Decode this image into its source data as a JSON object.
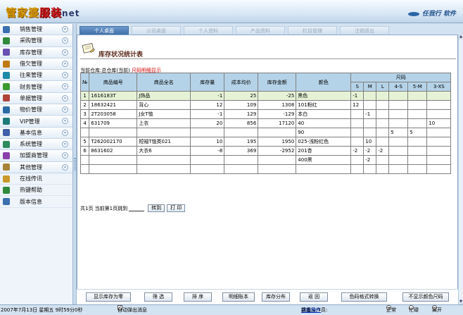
{
  "header": {
    "logo_part1": "管家婆",
    "logo_part2": "服装",
    "logo_part3": "net",
    "brand_text": "任我行 软件"
  },
  "sidebar": {
    "items": [
      {
        "label": "销售管理",
        "icon": "sales-icon",
        "color": "#3a6fb0"
      },
      {
        "label": "采购管理",
        "icon": "purchase-icon",
        "color": "#2f8a3c"
      },
      {
        "label": "库存管理",
        "icon": "inventory-icon",
        "color": "#6a4fb2"
      },
      {
        "label": "借欠管理",
        "icon": "loan-icon",
        "color": "#c07a14"
      },
      {
        "label": "往来管理",
        "icon": "contacts-icon",
        "color": "#1c8aa8"
      },
      {
        "label": "财务管理",
        "icon": "finance-icon",
        "color": "#3d9a2e"
      },
      {
        "label": "单据管理",
        "icon": "documents-icon",
        "color": "#b0443a"
      },
      {
        "label": "物价管理",
        "icon": "price-icon",
        "color": "#2c6aa6"
      },
      {
        "label": "VIP管理",
        "icon": "vip-icon",
        "color": "#1d7a7a"
      },
      {
        "label": "基本信息",
        "icon": "basic-info-icon",
        "color": "#3f5fa8"
      },
      {
        "label": "系统管理",
        "icon": "system-icon",
        "color": "#2d8a5a"
      },
      {
        "label": "加盟商管理",
        "icon": "franchise-icon",
        "color": "#8a3fa8"
      },
      {
        "label": "其他管理",
        "icon": "other-icon",
        "color": "#a8843a"
      }
    ],
    "plain_items": [
      {
        "label": "在线传讯",
        "icon": "speaker-icon",
        "color": "#c99a2a"
      },
      {
        "label": "热键帮助",
        "icon": "hotkey-icon",
        "color": "#2f8a3c"
      },
      {
        "label": "版本信息",
        "icon": "version-icon",
        "color": "#3a6fb0"
      }
    ]
  },
  "tabs": [
    "个人桌面",
    "公司桌面",
    "个人资料",
    "产品资料",
    "栏目管理",
    "注销退出"
  ],
  "report": {
    "title": "库存状况统计表",
    "warehouse_label": "当前仓库:总仓库(当前)",
    "size_detail_label": "尺码明细显示"
  },
  "table": {
    "headers": [
      "№",
      "商品编号",
      "商品全名",
      "库存量",
      "成本均价",
      "库存金额",
      "颜色",
      "尺码"
    ],
    "sizes": [
      "S",
      "M",
      "L",
      "4-S",
      "5-M",
      "3-XS"
    ],
    "rows": [
      {
        "no": "1",
        "code": "1616183T",
        "name": "J饰品",
        "qty": "-1",
        "avg": "25",
        "amount": "-25",
        "color": "黑色",
        "s": [
          "-1",
          "",
          "",
          "",
          "",
          ""
        ],
        "hl": true
      },
      {
        "no": "2",
        "code": "18632421",
        "name": "背心",
        "qty": "12",
        "avg": "109",
        "amount": "1308",
        "color": "101粉红",
        "s": [
          "12",
          "",
          "",
          "",
          "",
          ""
        ],
        "hl": false
      },
      {
        "no": "3",
        "code": "2T203058",
        "name": "J女T恤",
        "qty": "-1",
        "avg": "129",
        "amount": "-129",
        "color": "本白",
        "s": [
          "",
          "-1",
          "",
          "",
          "",
          ""
        ],
        "hl": false
      },
      {
        "no": "4",
        "code": "631709",
        "name": "上衣",
        "qty": "20",
        "avg": "856",
        "amount": "17120",
        "color": "40",
        "s": [
          "",
          "",
          "",
          "",
          "",
          "10"
        ],
        "hl": false
      },
      {
        "no": "",
        "code": "",
        "name": "",
        "qty": "",
        "avg": "",
        "amount": "",
        "color": "90",
        "s": [
          "",
          "",
          "",
          "5",
          "5",
          ""
        ],
        "hl": false
      },
      {
        "no": "5",
        "code": "T262002170",
        "name": "短袖T恤类021",
        "qty": "10",
        "avg": "195",
        "amount": "1950",
        "color": "025-浅粉红色",
        "s": [
          "",
          "10",
          "",
          "",
          "",
          ""
        ],
        "hl": false
      },
      {
        "no": "6",
        "code": "8631602",
        "name": "大衣6",
        "qty": "-8",
        "avg": "369",
        "amount": "-2952",
        "color": "201杏",
        "s": [
          "-2",
          "-2",
          "-2",
          "",
          "",
          ""
        ],
        "hl": false
      },
      {
        "no": "",
        "code": "",
        "name": "",
        "qty": "",
        "avg": "",
        "amount": "",
        "color": "400黑",
        "s": [
          "",
          "-2",
          "",
          "",
          "",
          ""
        ],
        "hl": false
      }
    ]
  },
  "pager": {
    "text": "共1页 当前第1页跳到",
    "goto_label": "转到",
    "print_label": "打 印"
  },
  "actions": [
    "显示库存为零",
    "筛 选",
    "排 序",
    "明细账本",
    "库存分布",
    "返 回",
    "色码格式转换",
    "不显示颜色尺码"
  ],
  "status": {
    "datetime": "2007年7月13日 星期五 9时59分0秒",
    "auto_popup": "自动弹出消息",
    "operator_label": "当前操作员:",
    "operator": "超级用户",
    "state_label": "状态:",
    "normal": "正常",
    "busy": "忙碌",
    "away": "离开"
  }
}
